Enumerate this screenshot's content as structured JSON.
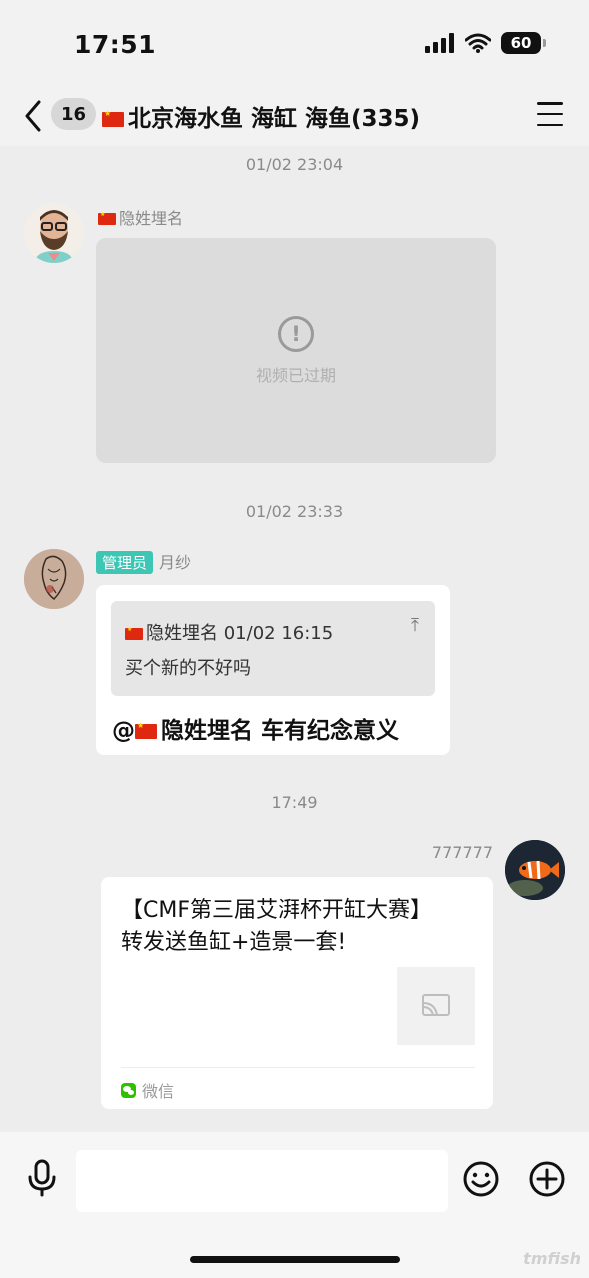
{
  "status_bar": {
    "time": "17:51",
    "battery": "60"
  },
  "header": {
    "unread_count": "16",
    "title": "北京海水鱼 海缸 海鱼(335)"
  },
  "messages": [
    {
      "timestamp": "01/02 23:04",
      "sender": "隐姓埋名",
      "video_expired_text": "视频已过期"
    },
    {
      "timestamp": "01/02 23:33",
      "role_tag": "管理员",
      "sender": "月纱",
      "quote": {
        "author": "隐姓埋名",
        "time": "01/02 16:15",
        "text": "买个新的不好吗"
      },
      "reply_mention": "@",
      "reply_mention_name": "隐姓埋名",
      "reply_text": "车有纪念意义"
    },
    {
      "timestamp": "17:49",
      "sender": "777777",
      "share_title": "【CMF第三届艾湃杯开缸大赛】转发送鱼缸+造景一套!",
      "share_source": "微信"
    }
  ],
  "watermark": "tmfish",
  "colors": {
    "admin_tag": "#3ec6b4",
    "background": "#ededed",
    "wechat": "#2dc100"
  }
}
